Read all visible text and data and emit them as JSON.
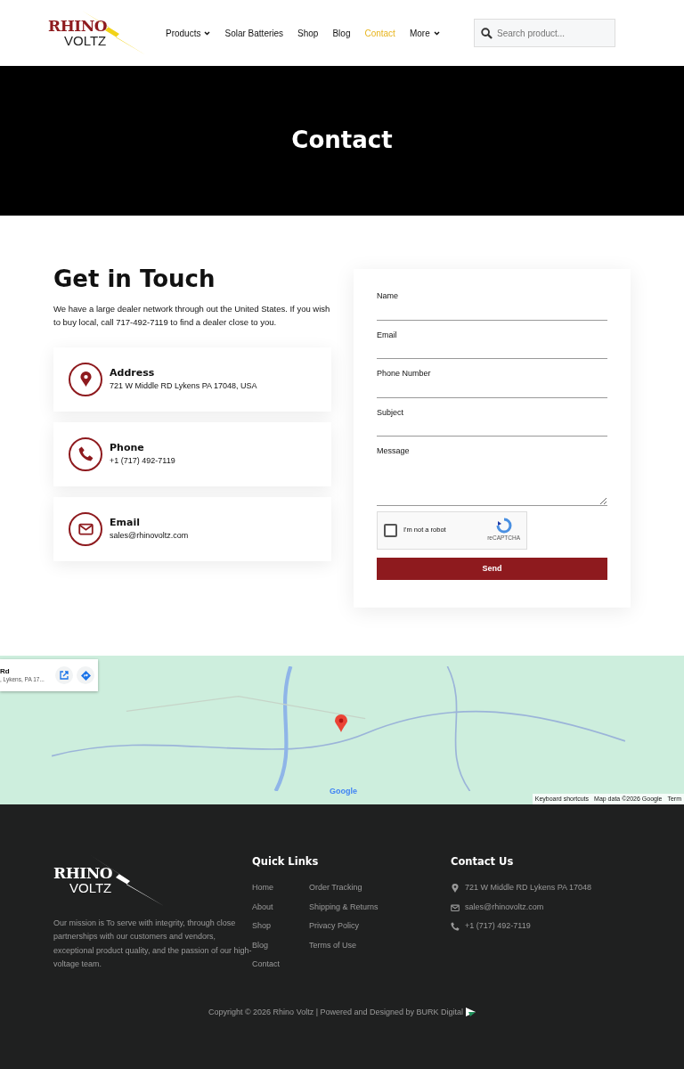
{
  "header": {
    "logo": {
      "line1": "RHINO",
      "line2": "VOLTZ"
    },
    "nav": [
      {
        "label": "Products",
        "selected": false,
        "dropdown": true
      },
      {
        "label": "Solar Batteries",
        "selected": false,
        "dropdown": false
      },
      {
        "label": "Shop",
        "selected": false,
        "dropdown": false
      },
      {
        "label": "Blog",
        "selected": false,
        "dropdown": false
      },
      {
        "label": "Contact",
        "selected": true,
        "dropdown": false
      },
      {
        "label": "More",
        "selected": false,
        "dropdown": true
      }
    ],
    "search": {
      "placeholder": "Search product..."
    }
  },
  "hero": {
    "title": "Contact"
  },
  "contact": {
    "heading": "Get in Touch",
    "intro": "We have a large dealer network through out the United States. If you wish to buy local, call 717-492-7119 to find a dealer close to you.",
    "cards": [
      {
        "kind": "address",
        "title": "Address",
        "value": "721 W Middle RD Lykens PA 17048, USA"
      },
      {
        "kind": "phone",
        "title": "Phone",
        "value": "+1 (717) 492-7119"
      },
      {
        "kind": "email",
        "title": "Email",
        "value": "sales@rhinovoltz.com"
      }
    ]
  },
  "form": {
    "fields": [
      {
        "label": "Name",
        "kind": "text"
      },
      {
        "label": "Email",
        "kind": "text"
      },
      {
        "label": "Phone Number",
        "kind": "text"
      },
      {
        "label": "Subject",
        "kind": "text"
      },
      {
        "label": "Message",
        "kind": "textarea"
      }
    ],
    "captcha": {
      "label": "I'm not a robot",
      "brand": "reCAPTCHA",
      "checked": false
    },
    "submit": "Send"
  },
  "map": {
    "card": {
      "title": "Rd",
      "subtitle": ", Lykens, PA 17..."
    },
    "logo": "Google",
    "attribution": [
      "Keyboard shortcuts",
      "Map data ©2026 Google",
      "Term"
    ]
  },
  "footer": {
    "logo": {
      "line1": "RHINO",
      "line2": "VOLTZ"
    },
    "mission": "Our mission is To serve with integrity, through close partnerships with our customers and vendors, exceptional product quality, and the passion of our high-voltage team.",
    "quick_links": {
      "heading": "Quick Links",
      "column_1": [
        "Home",
        "About",
        "Shop",
        "Blog",
        "Contact"
      ],
      "column_2": [
        "Order Tracking",
        "Shipping & Returns",
        "Privacy Policy",
        "Terms of Use"
      ]
    },
    "contact": {
      "heading": "Contact Us",
      "items": [
        {
          "kind": "address",
          "text": "721 W Middle RD Lykens PA 17048"
        },
        {
          "kind": "email",
          "text": "sales@rhinovoltz.com"
        },
        {
          "kind": "phone",
          "text": "+1 (717) 492-7119"
        }
      ]
    },
    "copyright": "Copyright © 2026 Rhino Voltz | Powered and Designed by BURK Digital"
  }
}
